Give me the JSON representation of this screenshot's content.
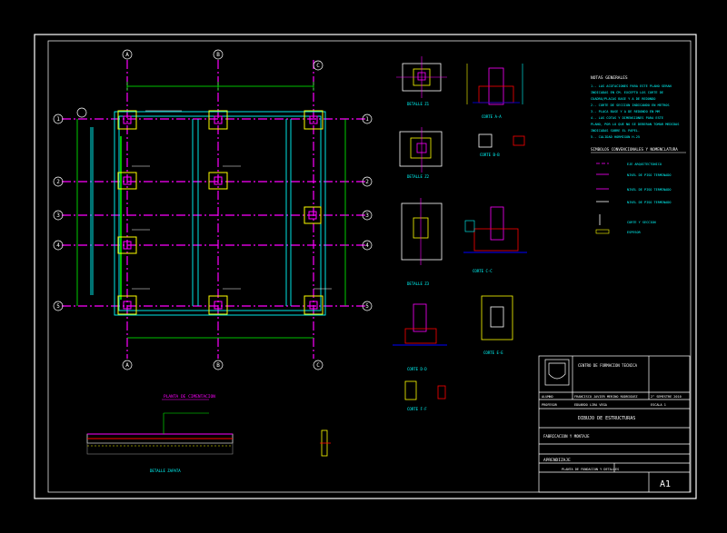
{
  "plan": {
    "title": "PLANTA DE CIMENTACION",
    "col_axes": [
      "A",
      "B",
      "C"
    ],
    "row_axes": [
      "1",
      "2",
      "3",
      "4",
      "5"
    ]
  },
  "notes": {
    "title": "NOTAS GENERALES",
    "items": [
      "1.- LAS ACOTACIONES PARA ESTE PLANO SERAN",
      "INDICADAS EN CM. EXCEPTO LOS CORTE DE",
      "CUADRO/PLACAS BASE Y A DE REDONDO",
      "2.- CORTE DE SECCION INDICANDO EN METROS",
      "3.- PLACA BASE Y A DE REDONDO EN MM",
      "4.- LAS COTAS Y DIMENSIONES PARA ESTE",
      "PLANO, POR LO QUE NO SE DEBERAN TOMAR MEDIDAS",
      "INDICADAS SOBRE EL PAPEL.",
      "5.- CALIDAD HORMIGON H-25"
    ],
    "symbols_title": "SIMBOLOS CONVENCIONALES Y NOMENCLATURA",
    "symbols": [
      "EJE ARQUITECTONICO",
      "NIVEL DE PISO TERMINADO",
      "NIVEL DE PISO TERMINADO",
      "NIVEL DE PISO TERMINADO",
      "CORTE Y SECCION",
      "ESPESOR"
    ]
  },
  "details": {
    "labels": [
      "DETALLE Z1",
      "CORTE A-A",
      "DETALLE Z2",
      "CORTE B-B",
      "DETALLE Z3",
      "CORTE C-C",
      "CORTE D-D",
      "CORTE E-E",
      "CORTE F-F",
      "DETALLE ZAPATA"
    ]
  },
  "title_block": {
    "institution": "CENTRO DE FORMACION TECNICA",
    "drawing_type": "DIBUJO DE ESTRUCTURAS",
    "subject": "FABRICACION Y MONTAJE",
    "student_label": "ALUMNO",
    "student": "FRANCISCO JAVIER MERINO RODRIGUEZ",
    "semester": "2° SEMESTRE 2010",
    "professor_label": "PROFESOR",
    "professor": "EDUARDO LIRA VEGA",
    "scale": "ESCALA 1",
    "program": "APRENDIZAJE",
    "sheet_title": "PLANTA DE FUNDACION Y DETALLES",
    "sheet_size": "A1"
  },
  "colors": {
    "background": "#000000",
    "frame": "#ffffff",
    "axis": "#ff00ff",
    "beam": "#00ffff",
    "column": "#ffff00",
    "dimension": "#00ff00",
    "text": "#ffffff",
    "rebar": "#ff0000",
    "section": "#0000ff"
  }
}
